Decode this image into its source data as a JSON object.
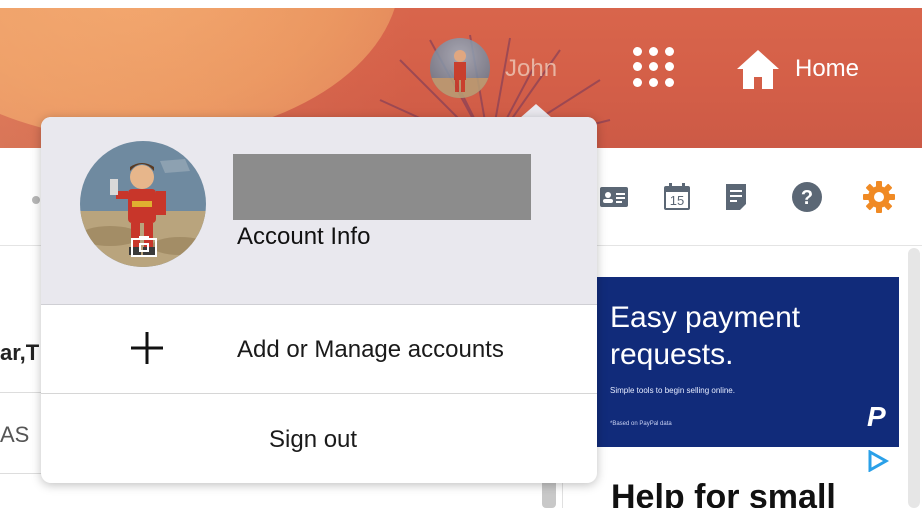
{
  "header": {
    "user_name": "John",
    "home_label": "Home",
    "apps_icon": "apps-grid-icon"
  },
  "toolbar": {
    "icons": [
      "contact-card-icon",
      "calendar-icon",
      "notepad-icon",
      "help-icon",
      "settings-gear-icon"
    ],
    "calendar_day": "15",
    "help_glyph": "?"
  },
  "account_menu": {
    "account_info_label": "Account Info",
    "add_manage_label": "Add or Manage accounts",
    "sign_out_label": "Sign out"
  },
  "left_panel": {
    "snippet_1": "ar,T",
    "snippet_2": "AS"
  },
  "ad": {
    "headline": "Easy payment requests.",
    "subtext": "Simple tools to begin selling online.",
    "footnote": "*Based on PayPal data",
    "logo": "P",
    "brand_color": "#112b7a"
  },
  "below_ad": {
    "headline": "Help for small"
  },
  "colors": {
    "banner": "#d45f48",
    "accent_orange": "#f08a24",
    "menu_header_bg": "#e9e8ee"
  }
}
